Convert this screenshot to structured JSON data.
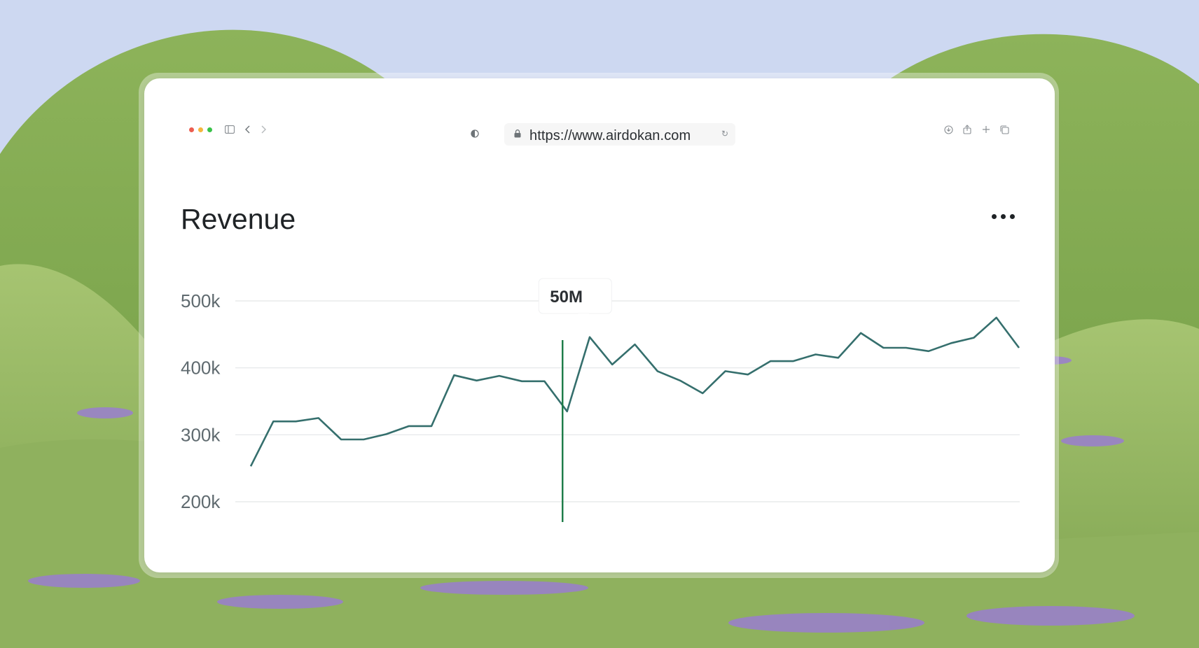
{
  "browser": {
    "url": "https://www.airdokan.com",
    "traffic_lights": [
      "#ec5d4f",
      "#f4b63e",
      "#39c249"
    ]
  },
  "card": {
    "title": "Revenue"
  },
  "chart_data": {
    "type": "line",
    "title": "Revenue",
    "xlabel": "",
    "ylabel": "",
    "yticks": [
      "500k",
      "400k",
      "300k",
      "200k"
    ],
    "ytick_values": [
      500000,
      400000,
      300000,
      200000
    ],
    "ylim": [
      200000,
      500000
    ],
    "grid": true,
    "line_color": "#356f6d",
    "cursor_color": "#1a7a45",
    "tooltip": {
      "label": "50M",
      "index": 13.8
    },
    "values": [
      253000,
      320000,
      320000,
      325000,
      293000,
      293000,
      301000,
      313000,
      313000,
      389000,
      381000,
      388000,
      380000,
      380000,
      335000,
      446000,
      405000,
      435000,
      395000,
      381000,
      362000,
      395000,
      390000,
      410000,
      410000,
      420000,
      415000,
      452000,
      430000,
      430000,
      425000,
      437000,
      445000,
      475000,
      430000
    ]
  }
}
